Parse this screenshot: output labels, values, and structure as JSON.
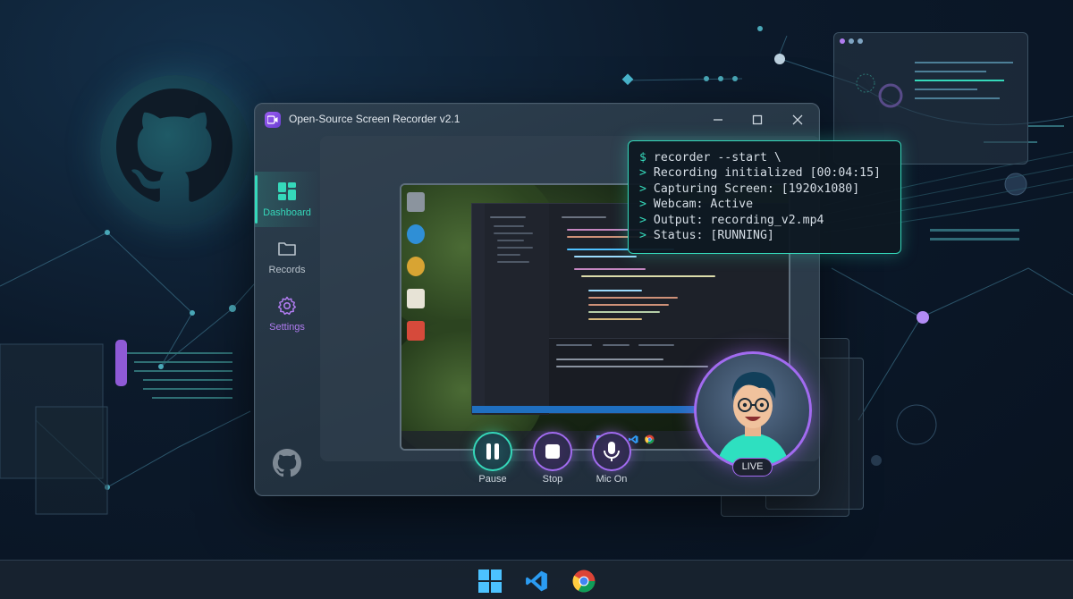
{
  "window": {
    "title": "Open-Source Screen Recorder v2.1",
    "controls": [
      "minimize",
      "maximize",
      "close"
    ]
  },
  "sidebar": {
    "items": [
      {
        "label": "Dashboard",
        "icon": "dashboard-grid-icon",
        "active": true
      },
      {
        "label": "Records",
        "icon": "folder-icon",
        "active": false
      },
      {
        "label": "Settings",
        "icon": "gear-icon",
        "active": false
      }
    ],
    "footer_icon": "github-icon"
  },
  "controls": {
    "pause_label": "Pause",
    "stop_label": "Stop",
    "mic_label": "Mic On"
  },
  "terminal": {
    "lines": [
      {
        "prefix": "$",
        "text": " recorder --start \\"
      },
      {
        "prefix": ">",
        "text": " Recording initialized [00:04:15]"
      },
      {
        "prefix": ">",
        "text": " Capturing Screen: [1920x1080]"
      },
      {
        "prefix": ">",
        "text": " Webcam: Active"
      },
      {
        "prefix": ">",
        "text": " Output: recording_v2.mp4"
      },
      {
        "prefix": ">",
        "text": " Status: [RUNNING]"
      }
    ]
  },
  "webcam": {
    "badge": "LIVE"
  },
  "taskbar": {
    "icons": [
      "windows-start-icon",
      "vscode-icon",
      "chrome-icon"
    ]
  },
  "colors": {
    "accent_teal": "#35d8ba",
    "accent_purple": "#a26bf0",
    "background": "#0c1a2b"
  }
}
